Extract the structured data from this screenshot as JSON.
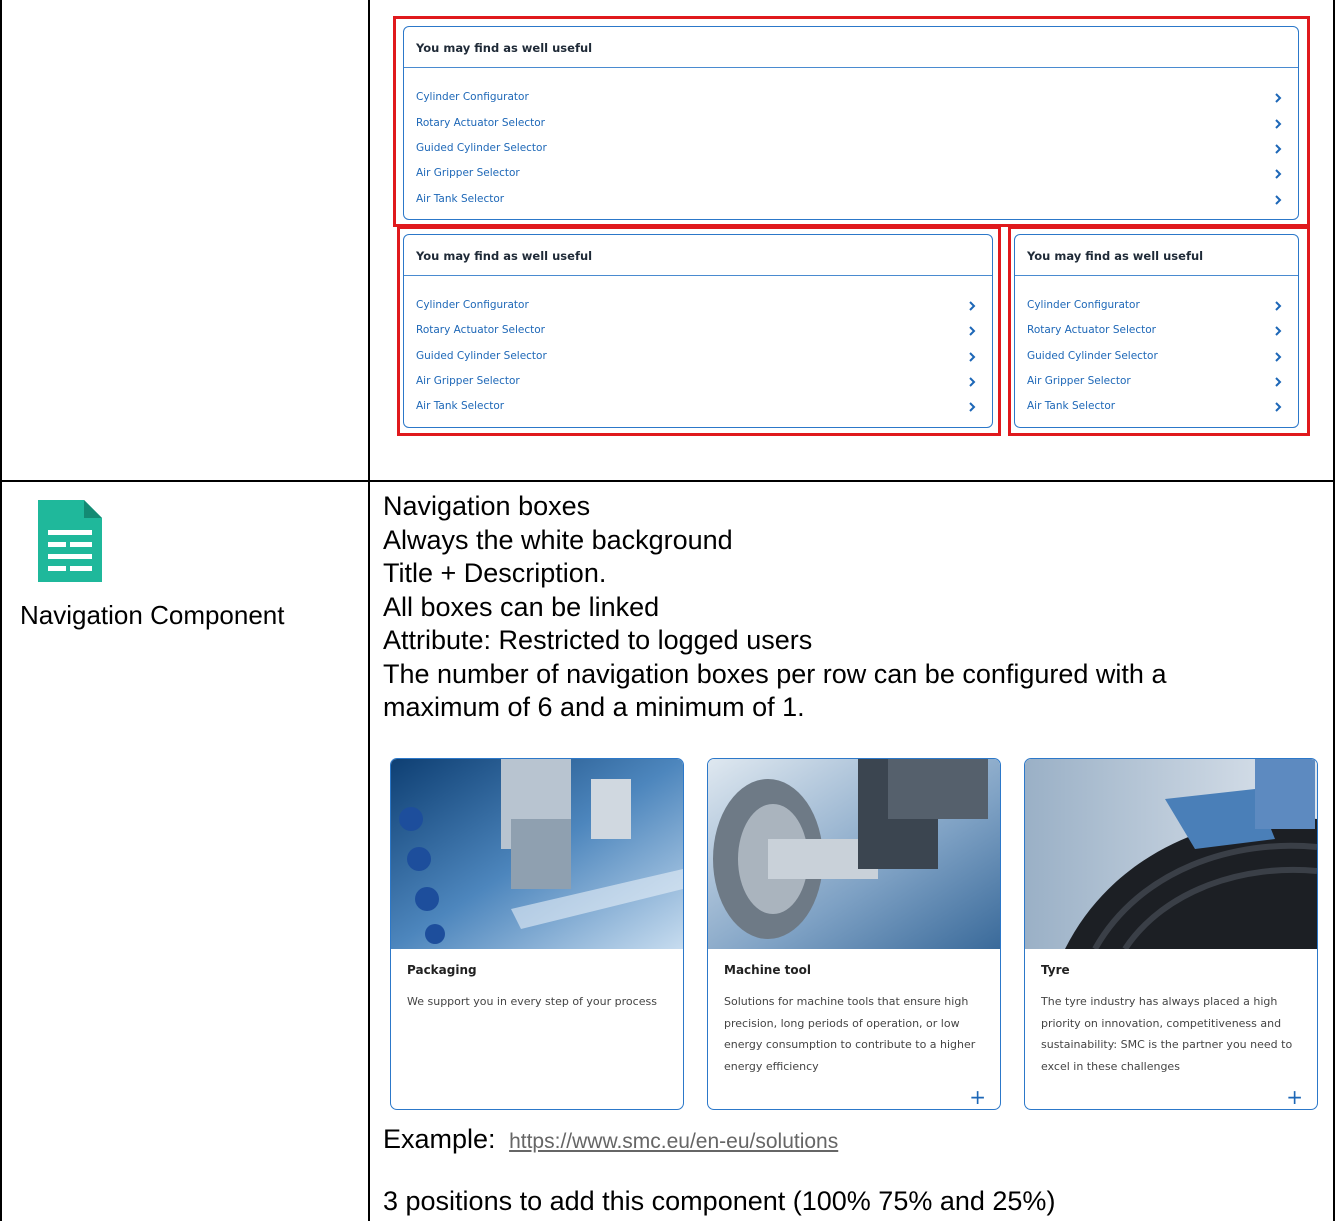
{
  "useful_boxes": {
    "title": "You may find as well useful",
    "links": [
      "Cylinder Configurator",
      "Rotary Actuator Selector",
      "Guided Cylinder Selector",
      "Air Gripper Selector",
      "Air Tank Selector"
    ]
  },
  "component": {
    "icon": "document-icon",
    "icon_color": "#1fb89b",
    "name": "Navigation Component"
  },
  "description": [
    "Navigation boxes",
    "Always the white background",
    "Title + Description.",
    "All boxes can be linked",
    "Attribute: Restricted to logged users",
    "The number of navigation boxes per row can be configured with a",
    "maximum of 6 and a minimum of 1."
  ],
  "cards": [
    {
      "title": "Packaging",
      "description": "We support you in every step of your process",
      "plus": ""
    },
    {
      "title": "Machine tool",
      "description": "Solutions for machine tools that ensure high precision, long periods of operation, or low energy consumption to contribute to a higher energy efficiency",
      "plus": "+"
    },
    {
      "title": "Tyre",
      "description": "The tyre industry has always placed a high priority on innovation, competitiveness and sustainability: SMC is the partner you need to excel in these challenges",
      "plus": "+"
    }
  ],
  "example": {
    "label": "Example:",
    "link": "https://www.smc.eu/en-eu/solutions"
  },
  "positions_text": "3 positions to add this component (100% 75% and 25%)",
  "colors": {
    "highlight": "#e0191d",
    "accent": "#1d67b7",
    "icon": "#1fb89b"
  }
}
